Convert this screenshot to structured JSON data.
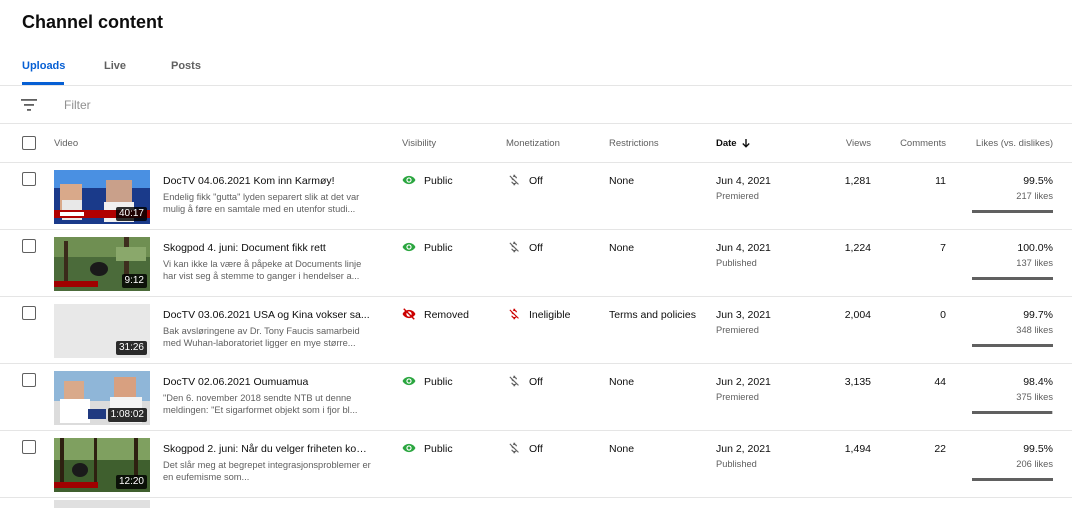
{
  "page": {
    "title": "Channel content"
  },
  "tabs": [
    {
      "label": "Uploads",
      "active": true
    },
    {
      "label": "Live",
      "active": false
    },
    {
      "label": "Posts",
      "active": false
    }
  ],
  "filter": {
    "placeholder": "Filter",
    "icon": "filter-icon"
  },
  "columns": {
    "video": "Video",
    "visibility": "Visibility",
    "monetization": "Monetization",
    "restrictions": "Restrictions",
    "date": "Date",
    "views": "Views",
    "comments": "Comments",
    "likes": "Likes (vs. dislikes)"
  },
  "colors": {
    "accent": "#065fd4",
    "public": "#2ba640",
    "removed": "#cc0000"
  },
  "rows": [
    {
      "title": "DocTV 04.06.2021 Kom inn Karmøy!",
      "description": "Endelig fikk \"gutta\" lyden separert slik at det var mulig å føre en samtale med en utenfor studi...",
      "duration": "40:17",
      "visibility": "Public",
      "monetization": "Off",
      "restrictions": "None",
      "date": "Jun 4, 2021",
      "date_status": "Premiered",
      "views": "1,281",
      "comments": "11",
      "likes_pct": "99.5%",
      "likes_count": "217 likes",
      "like_ratio": 0.995
    },
    {
      "title": "Skogpod 4. juni: Document fikk rett",
      "description": "Vi kan ikke la være å påpeke at Documents linje har vist seg å stemme to ganger i hendelser a...",
      "duration": "9:12",
      "visibility": "Public",
      "monetization": "Off",
      "restrictions": "None",
      "date": "Jun 4, 2021",
      "date_status": "Published",
      "views": "1,224",
      "comments": "7",
      "likes_pct": "100.0%",
      "likes_count": "137 likes",
      "like_ratio": 1.0
    },
    {
      "title": "DocTV 03.06.2021 USA og Kina vokser sa...",
      "description": "Bak avsløringene av Dr. Tony Faucis samarbeid med Wuhan-laboratoriet ligger en mye større...",
      "duration": "31:26",
      "visibility": "Removed",
      "monetization": "Ineligible",
      "restrictions": "Terms and policies",
      "date": "Jun 3, 2021",
      "date_status": "Premiered",
      "views": "2,004",
      "comments": "0",
      "likes_pct": "99.7%",
      "likes_count": "348 likes",
      "like_ratio": 0.997
    },
    {
      "title": "DocTV 02.06.2021 Oumuamua",
      "description": "\"Den 6. november 2018 sendte NTB ut denne meldingen: \"Et sigarformet objekt som i fjor bl...",
      "duration": "1:08:02",
      "visibility": "Public",
      "monetization": "Off",
      "restrictions": "None",
      "date": "Jun 2, 2021",
      "date_status": "Premiered",
      "views": "3,135",
      "comments": "44",
      "likes_pct": "98.4%",
      "likes_count": "375 likes",
      "like_ratio": 0.984
    },
    {
      "title": "Skogpod 2. juni: Når du velger friheten kom...",
      "description": "Det slår meg at begrepet integrasjonsproblemer er en eufemisme som...",
      "duration": "12:20",
      "visibility": "Public",
      "monetization": "Off",
      "restrictions": "None",
      "date": "Jun 2, 2021",
      "date_status": "Published",
      "views": "1,494",
      "comments": "22",
      "likes_pct": "99.5%",
      "likes_count": "206 likes",
      "like_ratio": 0.995
    }
  ]
}
